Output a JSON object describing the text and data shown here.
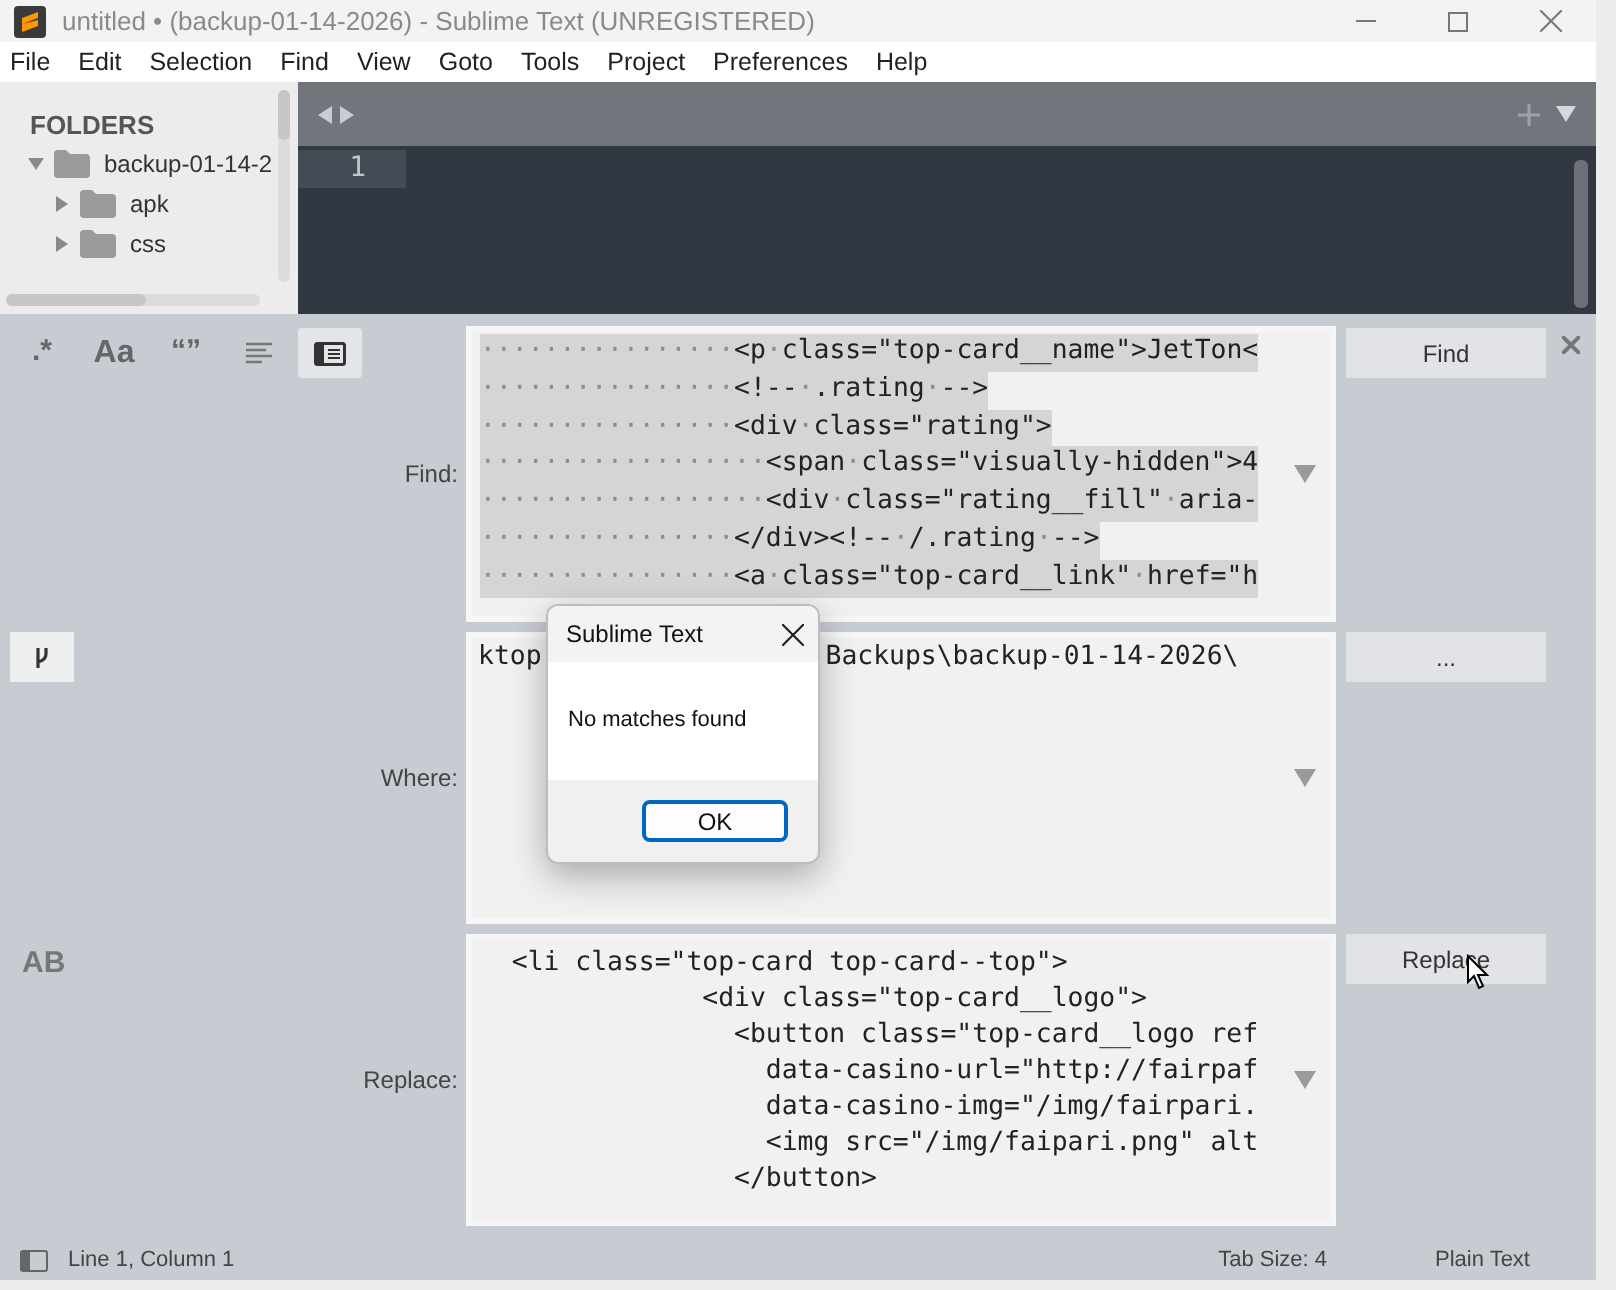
{
  "window": {
    "title": "untitled • (backup-01-14-2026) - Sublime Text (UNREGISTERED)"
  },
  "menu": [
    "File",
    "Edit",
    "Selection",
    "Find",
    "View",
    "Goto",
    "Tools",
    "Project",
    "Preferences",
    "Help"
  ],
  "sidebar": {
    "heading": "FOLDERS",
    "items": [
      {
        "label": "backup-01-14-2",
        "expanded": true,
        "children": [
          {
            "label": "apk",
            "expanded": false
          },
          {
            "label": "css",
            "expanded": false
          }
        ]
      }
    ]
  },
  "editor": {
    "line_numbers": [
      "1"
    ]
  },
  "find_panel": {
    "toggles": [
      {
        "kind": "text",
        "label": ".*",
        "on": false
      },
      {
        "kind": "text",
        "label": "Aa",
        "on": false
      },
      {
        "kind": "text",
        "label": "“”",
        "on": false
      },
      {
        "kind": "wrap",
        "on": false
      },
      {
        "kind": "selection",
        "on": true
      }
    ],
    "find": {
      "label": "Find:",
      "lines": [
        "················<p·class=\"top-card__name\">JetTon<",
        "················<!--·.rating·-->",
        "················<div·class=\"rating\">",
        "··················<span·class=\"visually-hidden\">4",
        "··················<div·class=\"rating__fill\"·aria-",
        "················</div><!--·/.rating·-->",
        "················<a·class=\"top-card__link\"·href=\"h"
      ],
      "button": "Find"
    },
    "where": {
      "label": "Where:",
      "value_parts": [
        "ktop",
        "Backups\\backup-01-14-2026\\"
      ],
      "button": "..."
    },
    "replace": {
      "toggle": "AB",
      "label": "Replace:",
      "lines": [
        "  <li class=\"top-card top-card--top\">",
        "              <div class=\"top-card__logo\">",
        "                <button class=\"top-card__logo ref",
        "                  data-casino-url=\"http://fairpaf",
        "                  data-casino-img=\"/img/fairpari.",
        "                  <img src=\"/img/faipari.png\" alt",
        "                </button>"
      ],
      "button": "Replace"
    }
  },
  "dialog": {
    "title": "Sublime Text",
    "message": "No matches found",
    "button": "OK"
  },
  "status_bar": {
    "position": "Line 1, Column 1",
    "tab_size": "Tab Size: 4",
    "syntax": "Plain Text"
  }
}
